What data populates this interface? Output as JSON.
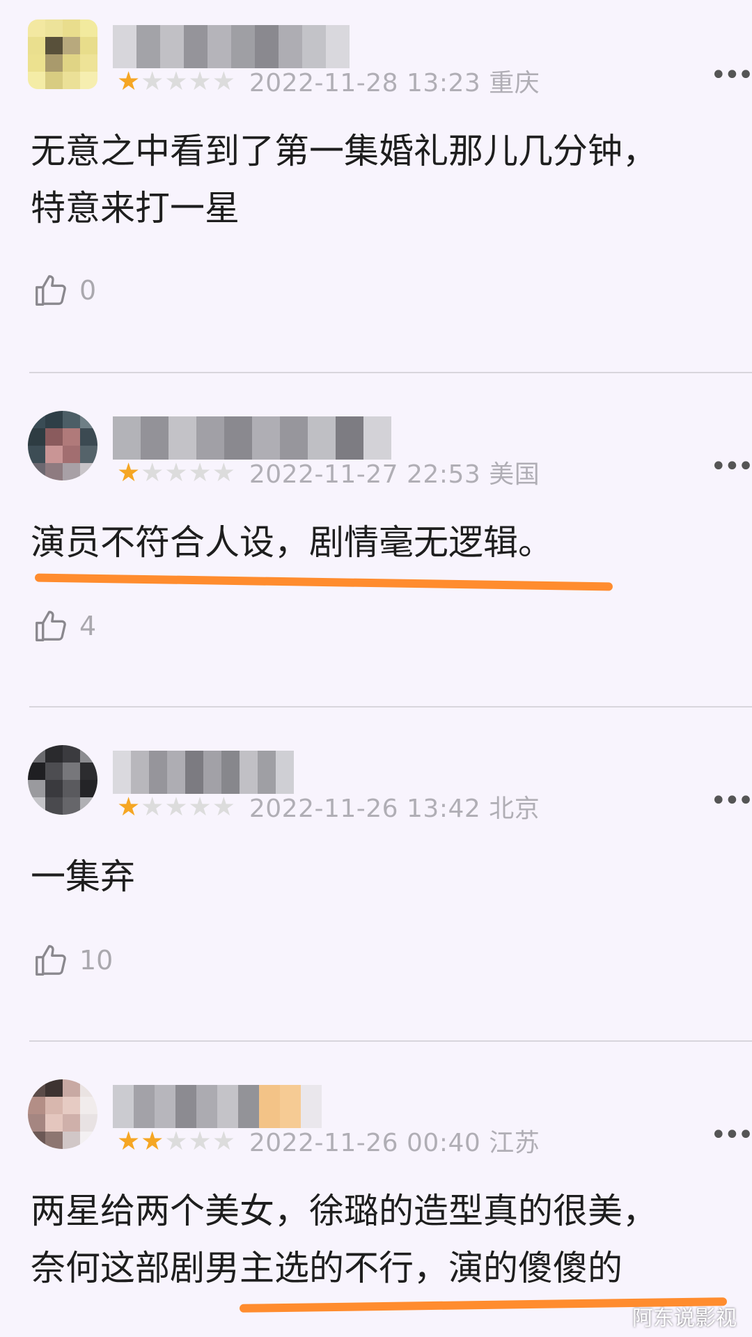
{
  "reviews": [
    {
      "rating": 1,
      "timestamp": "2022-11-28 13:23 重庆",
      "lines": [
        "无意之中看到了第一集婚礼那儿几分钟，",
        "特意来打一星"
      ],
      "likes": "0"
    },
    {
      "rating": 1,
      "timestamp": "2022-11-27 22:53 美国",
      "lines": [
        "演员不符合人设，剧情毫无逻辑。"
      ],
      "likes": "4"
    },
    {
      "rating": 1,
      "timestamp": "2022-11-26 13:42 北京",
      "lines": [
        "一集弃"
      ],
      "likes": "10"
    },
    {
      "rating": 2,
      "timestamp": "2022-11-26 00:40 江苏",
      "lines": [
        "两星给两个美女，徐璐的造型真的很美，",
        "奈何这部剧男主选的不行，演的傻傻的"
      ],
      "likes": ""
    }
  ],
  "icons": {
    "more": "more-dots-icon",
    "like": "thumbs-up-icon",
    "star": "star-icon"
  },
  "colors": {
    "star_on": "#f5a623",
    "star_off": "#dcdcdc",
    "underline": "#ff8c2e",
    "background": "#f8f4fd"
  },
  "watermark": "阿东说影视"
}
